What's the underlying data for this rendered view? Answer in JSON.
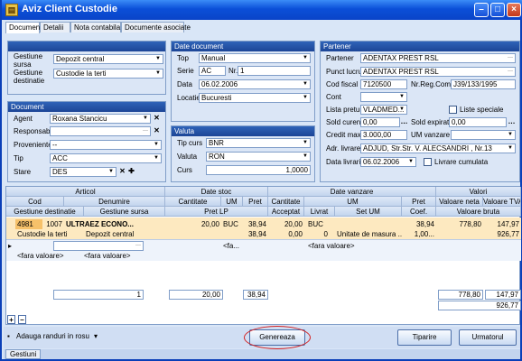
{
  "window": {
    "title": "Aviz Client Custodie",
    "icon": "document-icon"
  },
  "tabs": [
    "Document",
    "Detalii",
    "Nota contabila",
    "Documente asociate"
  ],
  "gestiune": {
    "sursa_label": "Gestiune sursa",
    "sursa": "Depozit central",
    "dest_label": "Gestiune destinatie",
    "dest": "Custodie la terti"
  },
  "document": {
    "title": "Document",
    "agent_label": "Agent",
    "agent": "Roxana Stancicu",
    "responsabil_label": "Responsabil",
    "responsabil": "",
    "proveniente_label": "Proveniente",
    "proveniente": "--",
    "tip_label": "Tip",
    "tip": "ACC",
    "stare_label": "Stare",
    "stare": "DES"
  },
  "date_document": {
    "title": "Date document",
    "top_label": "Top",
    "top": "Manual",
    "serie_label": "Serie",
    "serie": "AC",
    "nr_label": "Nr.",
    "nr": "1",
    "data_label": "Data",
    "data": "06.02.2006",
    "locatie_label": "Locatie",
    "locatie": "Bucuresti"
  },
  "valuta": {
    "title": "Valuta",
    "tip_curs_label": "Tip curs",
    "tip_curs": "BNR",
    "valuta_label": "Valuta",
    "valuta": "RON",
    "curs_label": "Curs",
    "curs": "1,0000"
  },
  "partener": {
    "title": "Partener",
    "partener_label": "Partener",
    "partener": "ADENTAX PREST RSL",
    "punct_label": "Punct lucru",
    "punct": "ADENTAX PREST RSL",
    "cod_label": "Cod fiscal",
    "cod": "7120500",
    "nrreg_label": "Nr.Reg.Com",
    "nrreg": "J39/133/1995",
    "cont_label": "Cont",
    "cont": "",
    "lista_label": "Lista preturi",
    "lista": "VLADMED...",
    "liste_speciale": "Liste speciale",
    "sold_curent_label": "Sold curent",
    "sold_curent": "0,00",
    "sold_expirat_label": "Sold expirat",
    "sold_expirat": "0,00",
    "credit_label": "Credit maxim",
    "credit": "3.000,00",
    "um_label": "UM vanzare",
    "um": "",
    "adr_label": "Adr. livrare",
    "adr": "ADJUD, Str.Str. V. ALECSANDRI , Nr.13",
    "data_liv_label": "Data livrarii",
    "data_liv": "06.02.2006",
    "livrare_cumulata": "Livrare cumulata"
  },
  "grid": {
    "group_headers": [
      "Articol",
      "Date stoc",
      "Date vanzare",
      "Valori"
    ],
    "h1": [
      "Cod",
      "Denumire",
      "Cantitate",
      "UM",
      "Pret",
      "Cantitate",
      "UM",
      "Pret",
      "Valoare neta",
      "Valoare TVA"
    ],
    "h2": [
      "Gestiune destinatie",
      "Gestiune sursa",
      "Pret LP",
      "Acceptat",
      "Livrat",
      "Set UM",
      "Coef.",
      "Valoare bruta"
    ],
    "row1": {
      "nr": "4981",
      "cod": "1007",
      "denumire": "ULTRAEZ ECONO...",
      "cantitate": "20,00",
      "um": "BUC",
      "pret": "38,94",
      "cantitate_v": "20,00",
      "um_v": "BUC",
      "pret_v": "38,94",
      "val_neta": "778,80",
      "val_tva": "147,97"
    },
    "row2": {
      "gest_dest": "Custodie la terti",
      "gest_sursa": "Depozit central",
      "pret_lp": "38,94",
      "acceptat": "0,00",
      "livrat": "0",
      "set_um": "Unitate de masura ...",
      "coef": "1,00...",
      "val_bruta": "926,77"
    },
    "filter": {
      "fa": "<fa...",
      "fara1": "<fara valoare>",
      "fara2": "<fara valoare>",
      "fara3": "<fara valoare>"
    },
    "totals": {
      "count": "1",
      "cant": "20,00",
      "pret": "38,94",
      "val_neta": "778,80",
      "val_tva": "147,97",
      "val_bruta": "926,77"
    }
  },
  "bottom": {
    "add_rows": "Adauga randuri in rosu",
    "genereaza": "Genereaza",
    "tiparire": "Tiparire",
    "urmatorul": "Urmatorul"
  },
  "status": {
    "tab": "Gestiuni"
  }
}
